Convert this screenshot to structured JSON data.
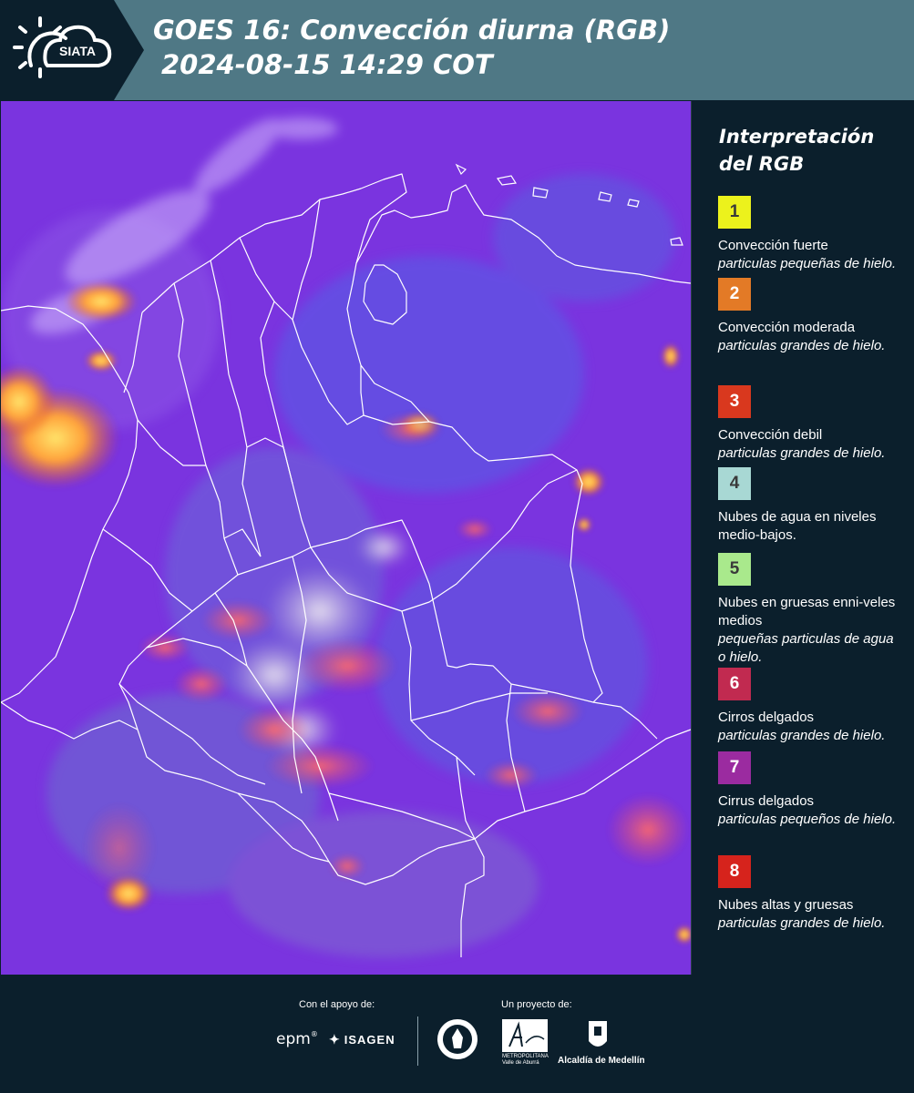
{
  "header": {
    "logo_text": "SIATA",
    "title_line1": "GOES 16: Convección diurna (RGB)",
    "title_line2": "2024-08-15 14:29 COT"
  },
  "legend": {
    "title": "Interpretación del RGB",
    "items": [
      {
        "number": "1",
        "color": "#ecf21c",
        "label": "Convección fuerte",
        "desc": "particulas pequeñas de hielo."
      },
      {
        "number": "2",
        "color": "#e37a26",
        "label": "Convección moderada",
        "desc": "particulas grandes de hielo."
      },
      {
        "number": "3",
        "color": "#d9381e",
        "label": "Convección debil",
        "desc": "particulas grandes de hielo."
      },
      {
        "number": "4",
        "color": "#a8d8d4",
        "label": "Nubes de agua en niveles medio-bajos.",
        "desc": ""
      },
      {
        "number": "5",
        "color": "#a9e98c",
        "label": "Nubes en gruesas enni-veles medios",
        "desc": "pequeñas particulas de agua o hielo."
      },
      {
        "number": "6",
        "color": "#c12a50",
        "label": "Cirros delgados",
        "desc": "particulas grandes de hielo."
      },
      {
        "number": "7",
        "color": "#9b2ba0",
        "label": "Cirrus delgados",
        "desc": "particulas pequeños de hielo."
      },
      {
        "number": "8",
        "color": "#d6231c",
        "label": "Nubes altas y gruesas",
        "desc": "particulas grandes de hielo."
      }
    ]
  },
  "footer": {
    "support_label": "Con el apoyo de:",
    "project_label": "Un proyecto de:",
    "sponsor1": "epm",
    "sponsor2": "ISAGEN",
    "amva_text": "METROPOLITANA Valle de Aburrá",
    "alcaldia": "Alcaldía de Medellín"
  },
  "colors": {
    "header_bg": "#4f7885",
    "panel_bg": "#0b1f2c",
    "map_base": "#7b33e0"
  }
}
